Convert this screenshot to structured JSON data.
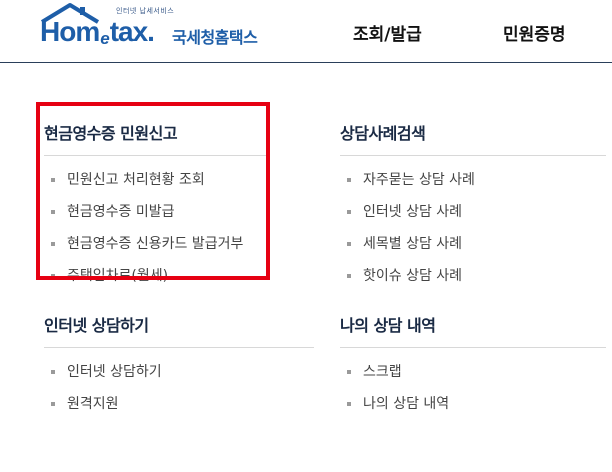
{
  "header": {
    "logo": {
      "tagline": "인터넷 납세서비스",
      "wordmark_pre": "Hom",
      "wordmark_e": "e",
      "wordmark_post": "tax.",
      "korean": "국세청홈택스"
    },
    "nav": [
      {
        "label": "조회/발급"
      },
      {
        "label": "민원증명"
      }
    ]
  },
  "sections": [
    {
      "title": "현금영수증 민원신고",
      "items": [
        "민원신고 처리현황 조회",
        "현금영수증 미발급",
        "현금영수증 신용카드 발급거부",
        "주택임차료(월세)"
      ]
    },
    {
      "title": "상담사례검색",
      "items": [
        "자주묻는 상담 사례",
        "인터넷 상담 사례",
        "세목별 상담 사례",
        "핫이슈 상담 사례"
      ]
    },
    {
      "title": "인터넷 상담하기",
      "items": [
        "인터넷 상담하기",
        "원격지원"
      ]
    },
    {
      "title": "나의 상담 내역",
      "items": [
        "스크랩",
        "나의 상담 내역"
      ]
    }
  ],
  "colors": {
    "highlight_border": "#e60012",
    "brand_blue": "#1e5ea8",
    "title_navy": "#1a2a44"
  }
}
